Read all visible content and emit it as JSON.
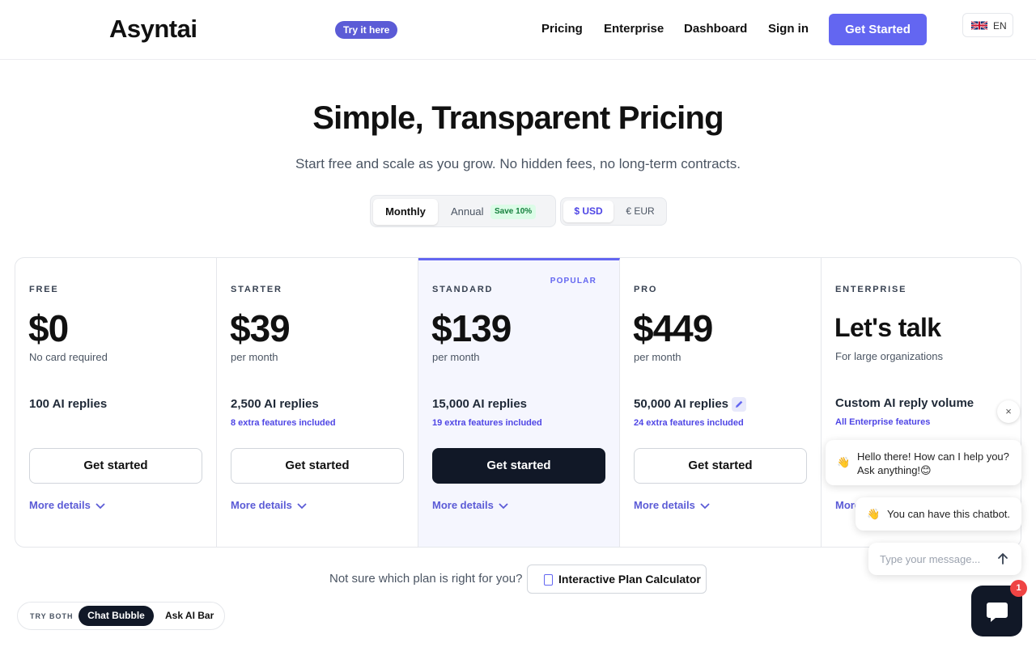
{
  "header": {
    "logo": "Asyntai",
    "try_pill": "Try it here",
    "nav": [
      "Pricing",
      "Enterprise",
      "Dashboard",
      "Sign in"
    ],
    "cta": "Get Started",
    "language": "EN",
    "language_icon": "uk-flag-icon"
  },
  "hero": {
    "title": "Simple, Transparent Pricing",
    "subtitle": "Start free and scale as you grow. No hidden fees, no long-term contracts."
  },
  "billing": {
    "monthly": "Monthly",
    "annual": "Annual",
    "save_badge": "Save 10%",
    "selected": "Monthly"
  },
  "currency": {
    "usd": "$ USD",
    "eur": "€ EUR",
    "selected": "$ USD"
  },
  "plans": [
    {
      "tier": "FREE",
      "price": "$0",
      "period": "No card required",
      "replies": "100 AI replies",
      "extra": "",
      "button": "Get started",
      "more": "More details"
    },
    {
      "tier": "STARTER",
      "price": "$39",
      "period": "per month",
      "replies": "2,500 AI replies",
      "extra": "8 extra features included",
      "button": "Get started",
      "more": "More details"
    },
    {
      "tier": "STANDARD",
      "badge": "POPULAR",
      "price": "$139",
      "period": "per month",
      "replies": "15,000 AI replies",
      "extra": "19 extra features included",
      "button": "Get started",
      "more": "More details"
    },
    {
      "tier": "PRO",
      "price": "$449",
      "period": "per month",
      "replies": "50,000 AI replies",
      "extra": "24 extra features included",
      "button": "Get started",
      "more": "More details"
    },
    {
      "tier": "ENTERPRISE",
      "price": "Let's talk",
      "period": "For large organizations",
      "replies": "Custom AI reply volume",
      "extra": "All Enterprise features",
      "button": "",
      "more": "More details"
    }
  ],
  "calculator": {
    "question": "Not sure which plan is right for you?",
    "button": "Interactive Plan Calculator"
  },
  "try_both": {
    "label": "TRY BOTH",
    "chat_bubble": "Chat Bubble",
    "ask_ai_bar": "Ask AI Bar"
  },
  "chat": {
    "close": "×",
    "message1": "Hello there! How can I help you? Ask anything!😊",
    "message2": "You can have this chatbot.",
    "wave": "👋",
    "input_placeholder": "Type your message...",
    "notification_count": "1"
  },
  "colors": {
    "accent": "#6366f1",
    "dark": "#111827",
    "popular_bg": "#f5f6fe",
    "save_green": "#15803d"
  }
}
